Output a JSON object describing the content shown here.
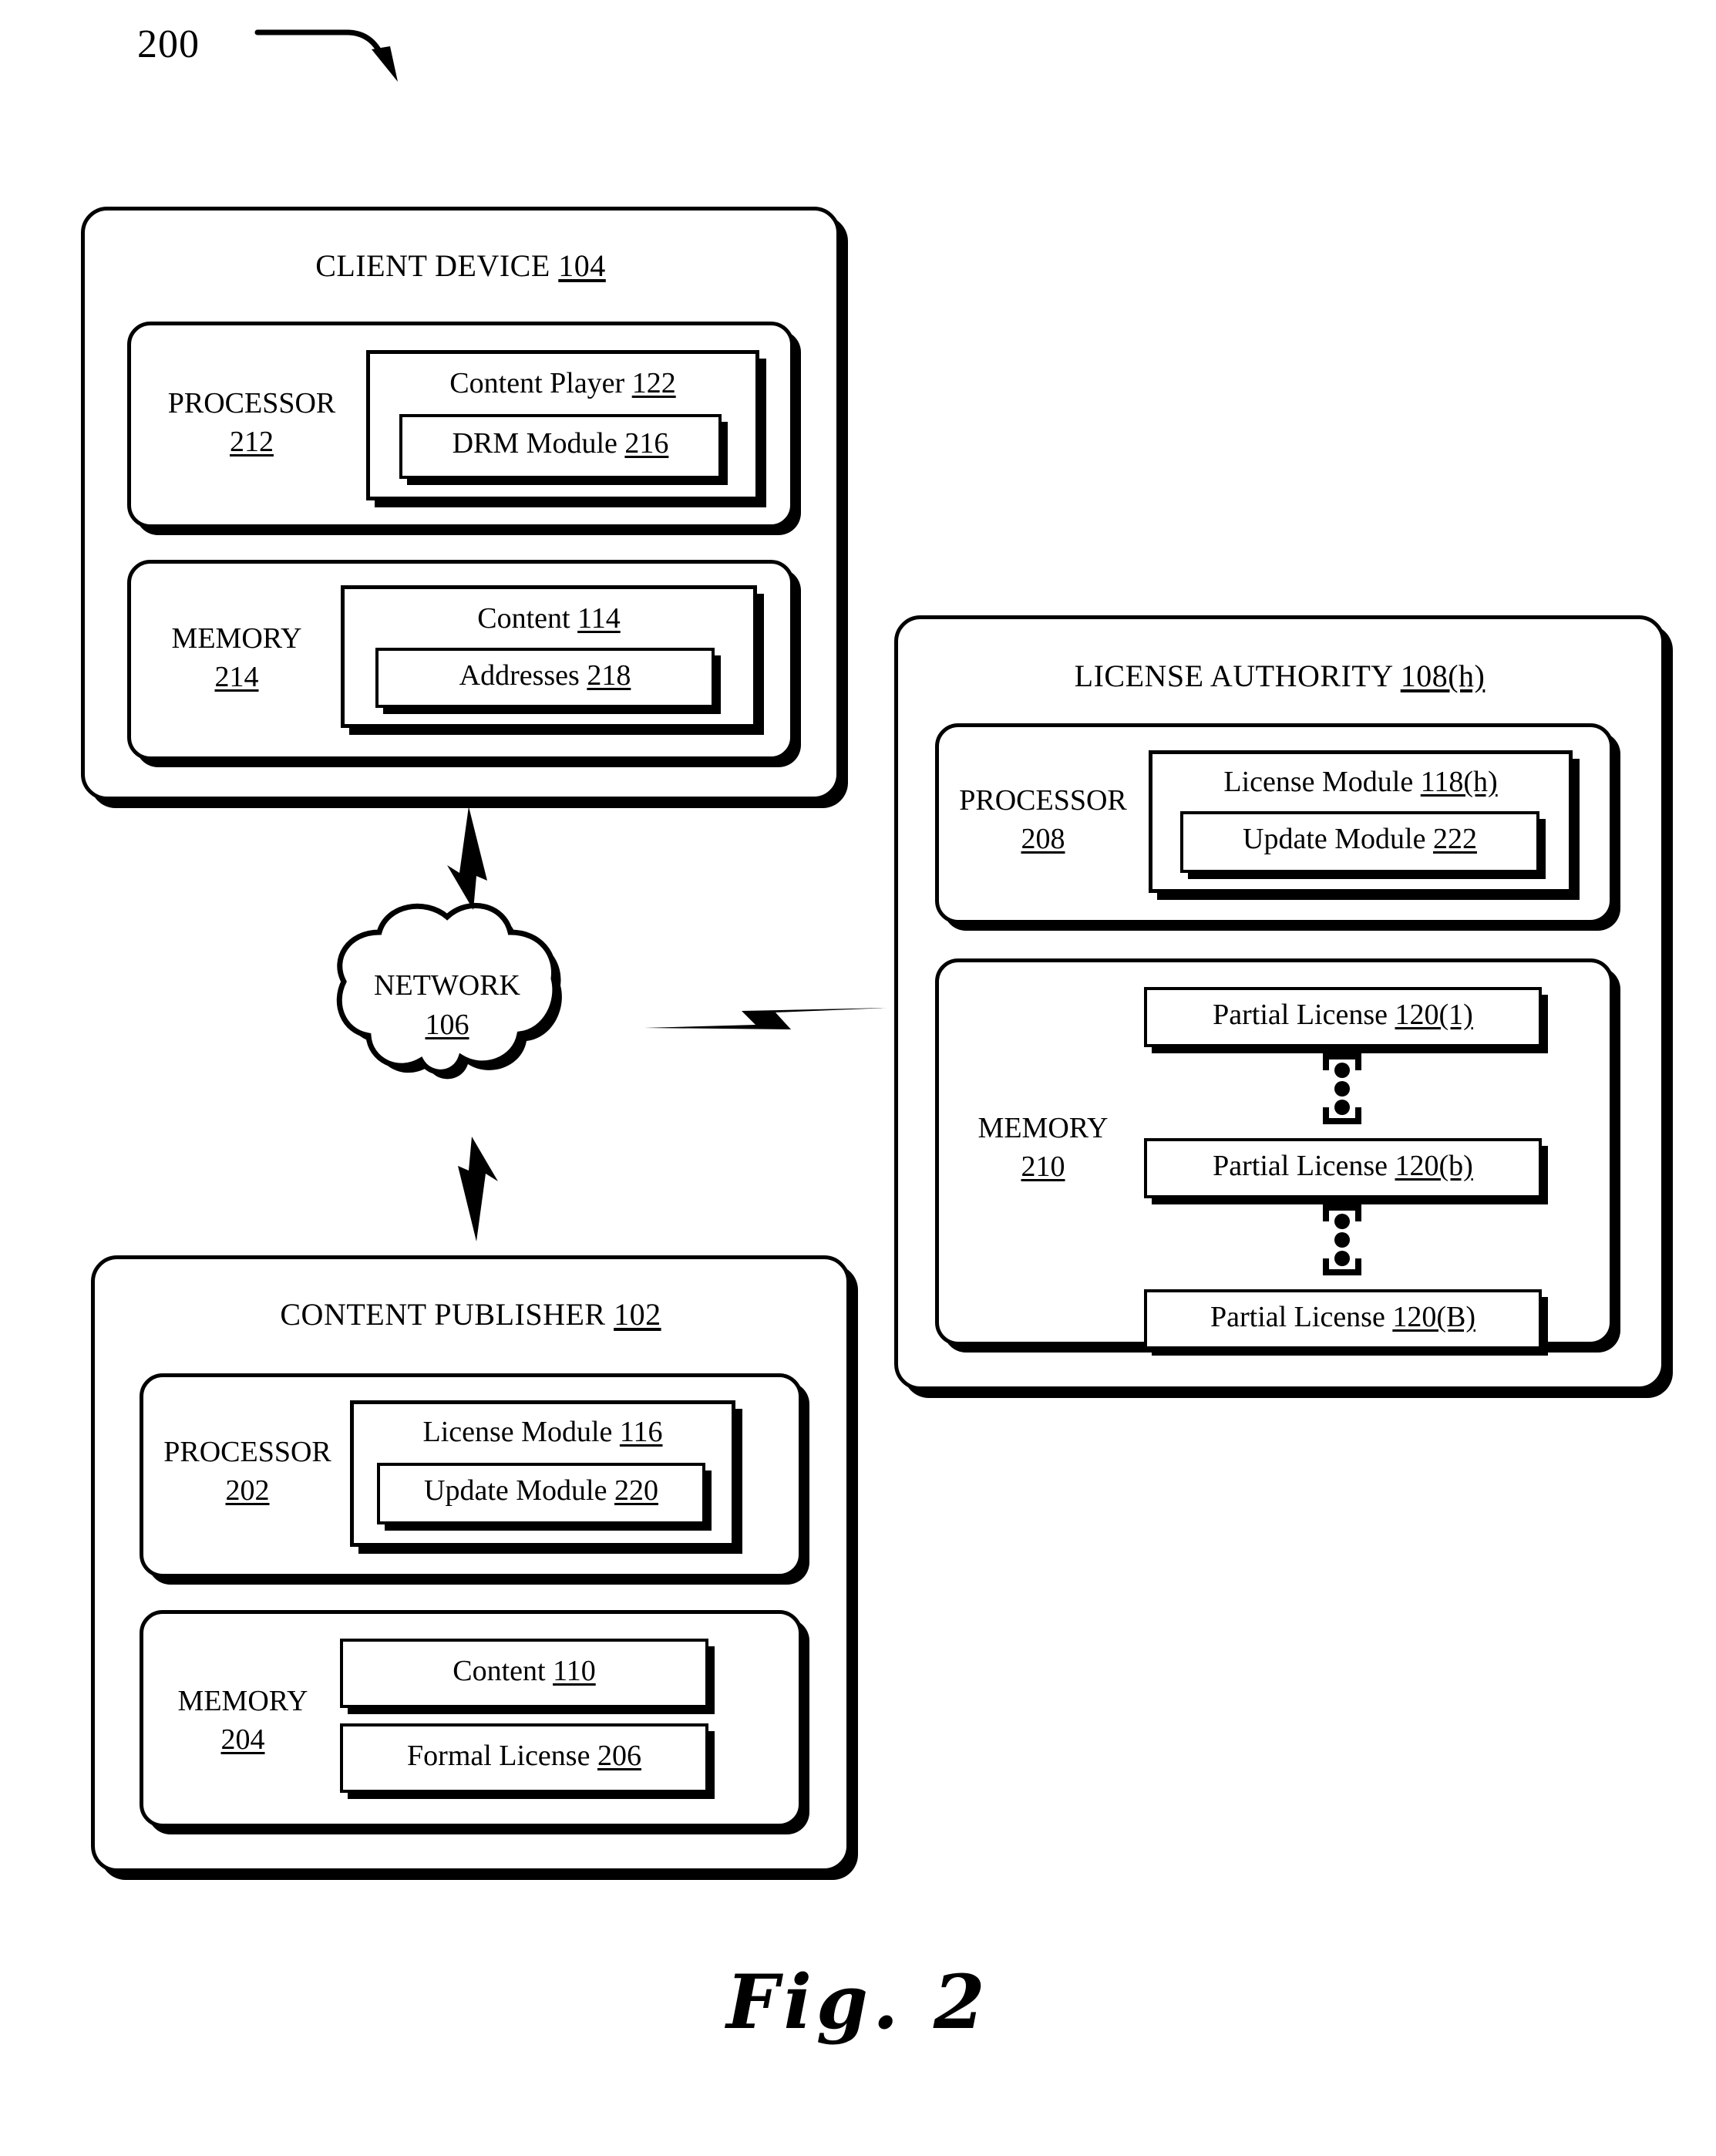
{
  "figure": {
    "ref_number": "200",
    "caption": "Fig. 2"
  },
  "client_device": {
    "title": "CLIENT DEVICE 104",
    "processor": {
      "label": "PROCESSOR",
      "number": "212"
    },
    "content_player": "Content Player 122",
    "drm_module": "DRM Module 216",
    "memory": {
      "label": "MEMORY",
      "number": "214"
    },
    "content": "Content 114",
    "addresses": "Addresses 218"
  },
  "license_authority": {
    "title": "LICENSE AUTHORITY 108(h)",
    "processor": {
      "label": "PROCESSOR",
      "number": "208"
    },
    "license_module": "License Module 118(h)",
    "update_module": "Update Module 222",
    "memory": {
      "label": "MEMORY",
      "number": "210"
    },
    "partial_licenses": [
      "Partial License 120(1)",
      "Partial License 120(b)",
      "Partial License 120(B)"
    ]
  },
  "content_publisher": {
    "title": "CONTENT PUBLISHER 102",
    "processor": {
      "label": "PROCESSOR",
      "number": "202"
    },
    "license_module": "License Module 116",
    "update_module": "Update Module 220",
    "memory": {
      "label": "MEMORY",
      "number": "204"
    },
    "content": "Content 110",
    "formal_license": "Formal License 206"
  },
  "network": {
    "label": "NETWORK",
    "number": "106"
  },
  "colors": {
    "ink": "#000000",
    "paper": "#ffffff"
  }
}
